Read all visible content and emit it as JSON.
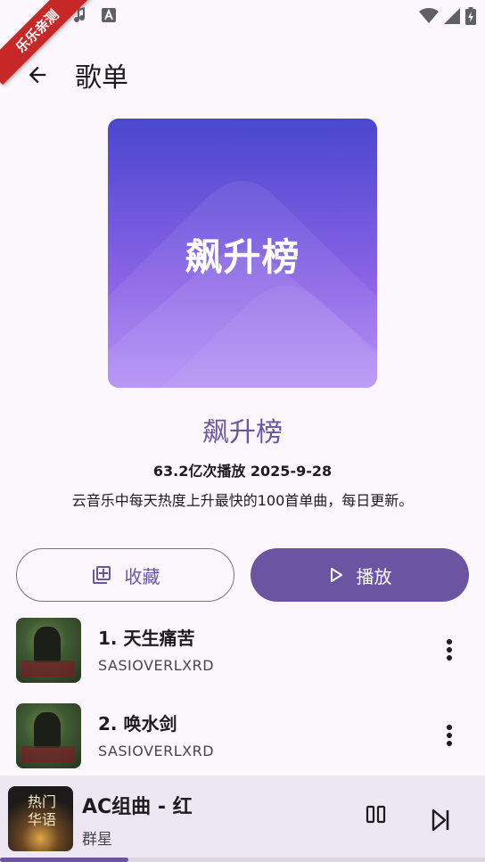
{
  "status_bar": {
    "ribbon_text": "乐乐亲测"
  },
  "header": {
    "title": "歌单"
  },
  "playlist": {
    "cover_text": "飙升榜",
    "name": "飙升榜",
    "stats": "63.2亿次播放  2025-9-28",
    "description": "云音乐中每天热度上升最快的100首单曲，每日更新。"
  },
  "actions": {
    "favorite_label": "收藏",
    "play_label": "播放"
  },
  "songs": [
    {
      "title": "1. 天生痛苦",
      "artist": "SASIOVERLXRD"
    },
    {
      "title": "2. 唤水剑",
      "artist": "SASIOVERLXRD"
    }
  ],
  "now_playing": {
    "title": "AC组曲 - 红",
    "artist": "群星",
    "cover_text": "热门\n华语",
    "progress": 0.265
  },
  "colors": {
    "accent": "#6b55a3",
    "background": "#fcf7fd",
    "ribbon": "#c62828"
  }
}
